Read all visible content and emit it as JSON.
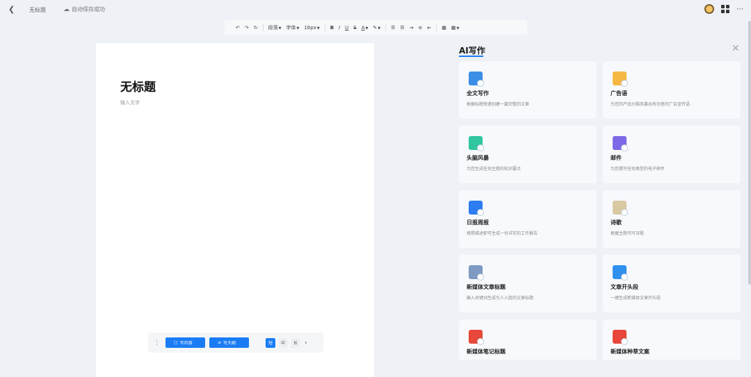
{
  "header": {
    "back_icon": "chevron-left-icon",
    "doc_title": "无标题",
    "save_status": "自动保存成功"
  },
  "toolbar": {
    "paragraph": "段落",
    "font": "字体",
    "font_size": "16px",
    "bold": "B",
    "italic": "I",
    "underline": "U",
    "strike": "S",
    "font_color": "A"
  },
  "document": {
    "title": "无标题",
    "placeholder": "输入文字"
  },
  "floatbar": {
    "write_content": "写内容",
    "write_outline": "写大纲",
    "size_options": [
      "短",
      "中",
      "长"
    ],
    "selected_size": "短"
  },
  "ai_panel": {
    "title": "AI写作",
    "cards": [
      {
        "name": "全文写作",
        "desc": "根据标题快速创建一篇完整的文章",
        "icon": "document-icon",
        "color": "#3a8ee6"
      },
      {
        "name": "广告语",
        "desc": "为您的产品头脑风暴出有创意的广告宣传语",
        "icon": "folder-icon",
        "color": "#f5b843"
      },
      {
        "name": "头脑风暴",
        "desc": "为您生成任何主题的知识要点",
        "icon": "list-icon",
        "color": "#2fc6a0"
      },
      {
        "name": "邮件",
        "desc": "为您撰写任何类型的电子邮件",
        "icon": "mail-icon",
        "color": "#7d68e8"
      },
      {
        "name": "日报周报",
        "desc": "按照描述即可生成一份详实的工作报告",
        "icon": "book-icon",
        "color": "#2d7cf0"
      },
      {
        "name": "诗歌",
        "desc": "根据主题书写诗歌",
        "icon": "scroll-icon",
        "color": "#d9c9a3"
      },
      {
        "name": "新媒体文章标题",
        "desc": "输入关键词生成引人入胜的文章标题",
        "icon": "headline-icon",
        "color": "#7f9ac2"
      },
      {
        "name": "文章开头段",
        "desc": "一键生成新媒体文章开头段",
        "icon": "paragraph-icon",
        "color": "#2f90ee"
      },
      {
        "name": "新媒体笔记标题",
        "desc": "",
        "icon": "note-icon",
        "color": "#e8473b"
      },
      {
        "name": "新媒体种草文案",
        "desc": "",
        "icon": "note-icon",
        "color": "#e8473b"
      }
    ]
  }
}
